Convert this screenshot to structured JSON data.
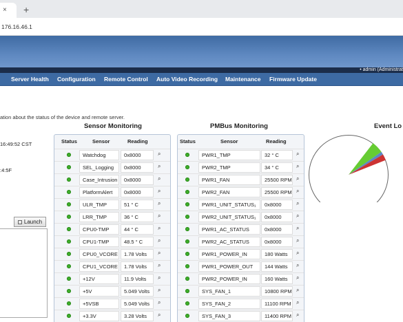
{
  "browser": {
    "url": "176.16.46.1",
    "tab_close": "×",
    "new_tab": "+"
  },
  "header": {
    "user_text": "• admin (Administrat"
  },
  "menu": [
    "Server Health",
    "Configuration",
    "Remote Control",
    "Auto Video Recording",
    "Maintenance",
    "Firmware Update"
  ],
  "intro": "ation about the status of the device and remote server.",
  "left": {
    "time": "16:49:52 CST",
    "fragment": ":4:5F",
    "launch_label": "Launch"
  },
  "sensor_panel": {
    "title": "Sensor Monitoring",
    "columns": [
      "Status",
      "Sensor",
      "Reading"
    ],
    "rows": [
      {
        "sensor": "Watchdog",
        "reading": "0x8000"
      },
      {
        "sensor": "SEL_Logging",
        "reading": "0x8000"
      },
      {
        "sensor": "Case_Intrusion",
        "reading": "0x8000"
      },
      {
        "sensor": "PlatformAlert",
        "reading": "0x8000"
      },
      {
        "sensor": "ULR_TMP",
        "reading": "51 ° C"
      },
      {
        "sensor": "LRR_TMP",
        "reading": "36 ° C"
      },
      {
        "sensor": "CPU0-TMP",
        "reading": "44 ° C"
      },
      {
        "sensor": "CPU1-TMP",
        "reading": "48.5 ° C"
      },
      {
        "sensor": "CPU0_VCORE",
        "reading": "1.78 Volts"
      },
      {
        "sensor": "CPU1_VCORE",
        "reading": "1.78 Volts"
      },
      {
        "sensor": "+12V",
        "reading": "11.9 Volts"
      },
      {
        "sensor": "+5V",
        "reading": "5.049 Volts"
      },
      {
        "sensor": "+5VSB",
        "reading": "5.049 Volts"
      },
      {
        "sensor": "+3.3V",
        "reading": "3.28 Volts"
      }
    ]
  },
  "pmbus_panel": {
    "title": "PMBus Monitoring",
    "columns": [
      "Status",
      "Sensor",
      "Reading"
    ],
    "rows": [
      {
        "sensor": "PWR1_TMP",
        "reading": "32 ° C"
      },
      {
        "sensor": "PWR2_TMP",
        "reading": "34 ° C"
      },
      {
        "sensor": "PWR1_FAN",
        "reading": "25500 RPM"
      },
      {
        "sensor": "PWR2_FAN",
        "reading": "25500 RPM"
      },
      {
        "sensor": "PWR1_UNIT_STATUS₁",
        "reading": "0x8000"
      },
      {
        "sensor": "PWR2_UNIT_STATUS₁",
        "reading": "0x8000"
      },
      {
        "sensor": "PWR1_AC_STATUS",
        "reading": "0x8000"
      },
      {
        "sensor": "PWR2_AC_STATUS",
        "reading": "0x8000"
      },
      {
        "sensor": "PWR1_POWER_IN",
        "reading": "180 Watts"
      },
      {
        "sensor": "PWR1_POWER_OUT",
        "reading": "144 Watts"
      },
      {
        "sensor": "PWR2_POWER_IN",
        "reading": "160 Watts"
      },
      {
        "sensor": "SYS_FAN_1",
        "reading": "10800 RPM"
      },
      {
        "sensor": "SYS_FAN_2",
        "reading": "11100 RPM"
      },
      {
        "sensor": "SYS_FAN_3",
        "reading": "11400 RPM"
      }
    ]
  },
  "event_log": {
    "title": "Event Lo",
    "slices": [
      {
        "fraction": 0.915,
        "color": "#ffffff"
      },
      {
        "fraction": 0.048,
        "color": "#66cc33"
      },
      {
        "fraction": 0.012,
        "color": "#5b88c4"
      },
      {
        "fraction": 0.025,
        "color": "#cc3333"
      }
    ]
  },
  "colors": {
    "ok_status": "#3fae2b",
    "menubar": "#3d6aa3",
    "banner": "#5e88c0"
  }
}
